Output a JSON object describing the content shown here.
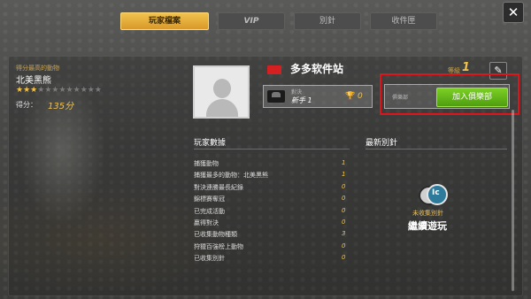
{
  "tabs": [
    {
      "label": "玩家檔案",
      "active": true
    },
    {
      "label": "VIP",
      "active": false
    },
    {
      "label": "別針",
      "active": false
    },
    {
      "label": "收件匣",
      "active": false
    }
  ],
  "close_label": "✕",
  "best_animal": {
    "label": "得分最高的動物",
    "name": "北美黑熊",
    "stars_filled": 3,
    "stars_total": 12
  },
  "score": {
    "label": "得分：",
    "value": "135分"
  },
  "player": {
    "name": "多多软件站",
    "level_label": "等級",
    "level": "1",
    "edit_icon": "✎"
  },
  "duel": {
    "label": "對決",
    "value": "新手 1",
    "trophy_icon": "🏆",
    "trophies": "0"
  },
  "club": {
    "label": "俱樂部",
    "join_label": "加入俱樂部"
  },
  "sections": {
    "player_data": "玩家數據",
    "latest_pins": "最新別針"
  },
  "stats": [
    {
      "label": "捕獲動物",
      "value": "1"
    },
    {
      "label": "捕獲最多的動物：北美黑熊",
      "value": "1"
    },
    {
      "label": "對決連勝最長紀錄",
      "value": "0"
    },
    {
      "label": "錦標賽奪冠",
      "value": "0"
    },
    {
      "label": "已完成活動",
      "value": "0"
    },
    {
      "label": "贏得對決",
      "value": "0"
    },
    {
      "label": "已收集動物種類",
      "value": "3"
    },
    {
      "label": "狩獵百強榜上動物",
      "value": "0"
    },
    {
      "label": "已收集別針",
      "value": "0"
    }
  ],
  "pins": {
    "uncollected": "未收集別針",
    "continue": "繼續遊玩"
  },
  "colors": {
    "accent": "#f1c24c",
    "join_green": "#5fb518",
    "highlight_red": "#e0141b",
    "flag_red": "#d42020"
  }
}
